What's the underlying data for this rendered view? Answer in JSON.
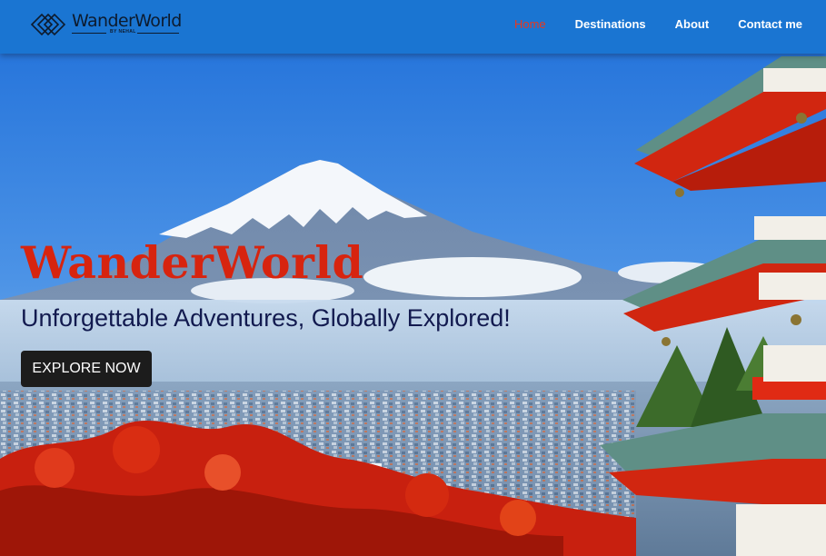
{
  "navbar": {
    "brand": {
      "name": "WanderWorld",
      "byline": "BY NEHAL",
      "icon": "diamond-logo-icon"
    },
    "links": [
      {
        "label": "Home",
        "active": true
      },
      {
        "label": "Destinations",
        "active": false
      },
      {
        "label": "About",
        "active": false
      },
      {
        "label": "Contact me",
        "active": false
      }
    ]
  },
  "hero": {
    "title": "WanderWorld",
    "subtitle": "Unforgettable Adventures, Globally Explored!",
    "cta_label": "EXPLORE NOW",
    "background_image": "mount-fuji-pagoda-autumn-photo"
  },
  "colors": {
    "navbar_bg": "#1a75d2",
    "active_link": "#e8381e",
    "title": "#d7240f",
    "subtitle": "#121a4f",
    "button_bg": "#1c1c1c"
  }
}
